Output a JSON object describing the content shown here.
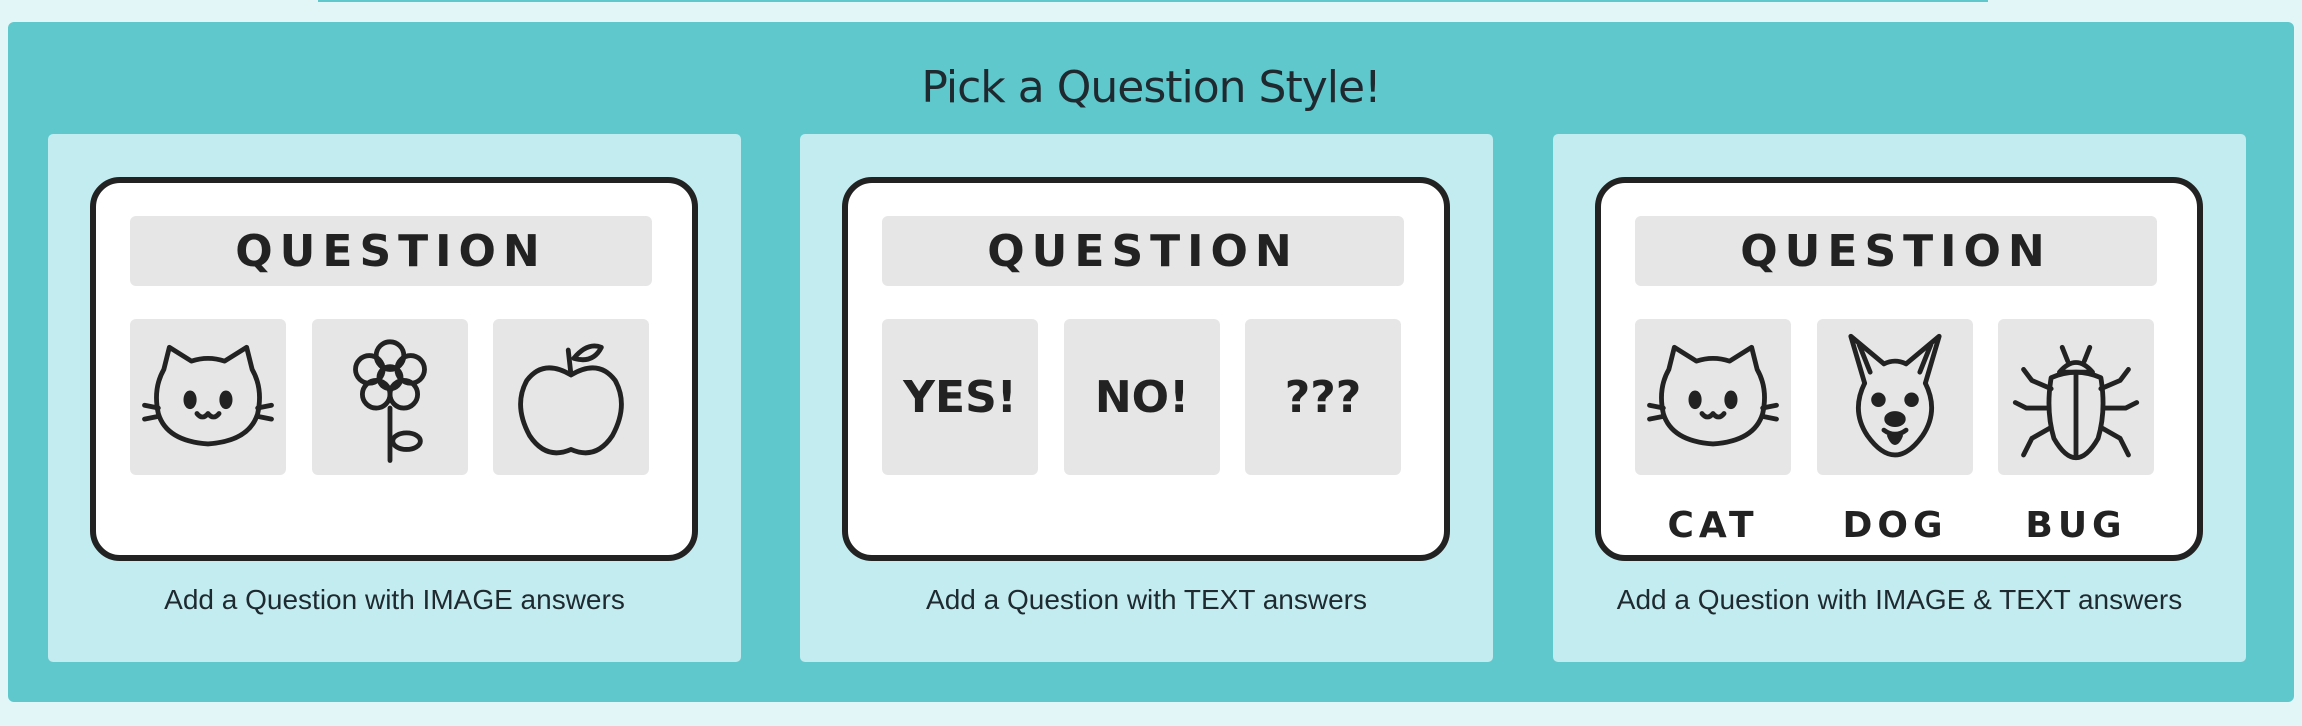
{
  "panel": {
    "title": "Pick a Question Style!"
  },
  "options": [
    {
      "card_heading": "QUESTION",
      "tiles": [
        "cat-icon",
        "flower-icon",
        "apple-icon"
      ],
      "caption": "Add a Question with IMAGE answers"
    },
    {
      "card_heading": "QUESTION",
      "tiles": [
        "YES!",
        "NO!",
        "???"
      ],
      "caption": "Add a Question with TEXT answers"
    },
    {
      "card_heading": "QUESTION",
      "tiles": [
        "cat-icon",
        "dog-icon",
        "bug-icon"
      ],
      "labels": [
        "CAT",
        "DOG",
        "BUG"
      ],
      "caption": "Add a Question with IMAGE & TEXT answers"
    }
  ],
  "colors": {
    "page_bg": "#e3f6f7",
    "panel_bg": "#5ec8cc",
    "option_bg": "#c2ecef",
    "tile_bg": "#e6e6e6"
  }
}
